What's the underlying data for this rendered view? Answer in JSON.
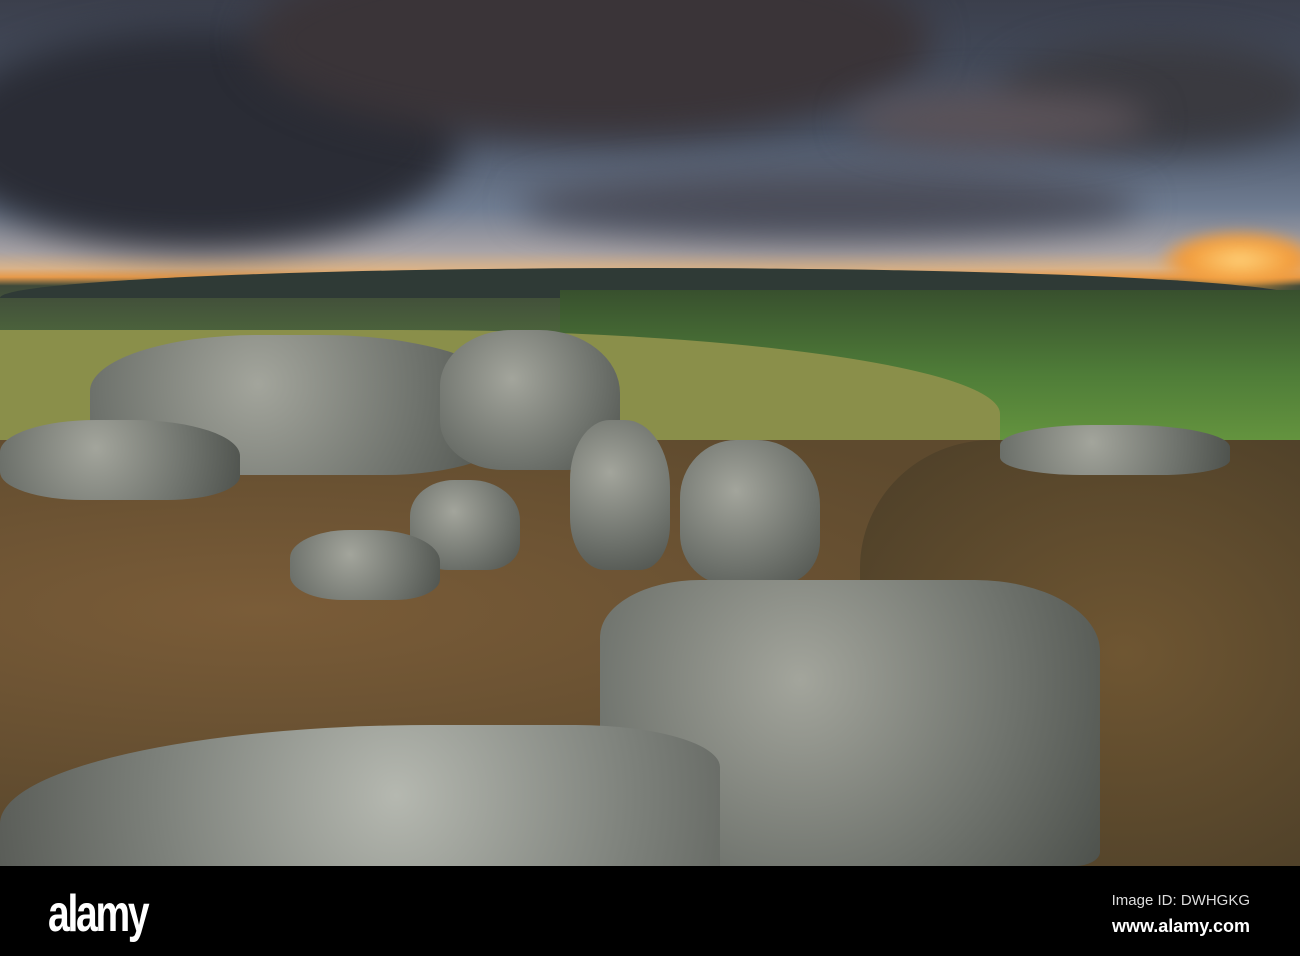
{
  "footer": {
    "logo": "alamy",
    "image_id": "Image ID: DWHGKG",
    "url": "www.alamy.com"
  }
}
